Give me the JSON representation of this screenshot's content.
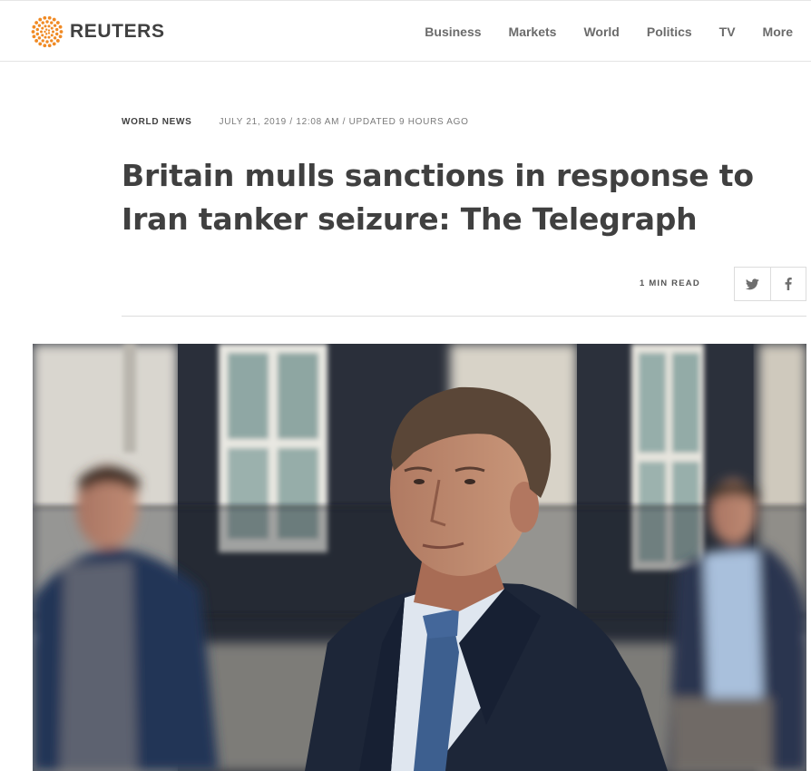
{
  "header": {
    "logo": {
      "name": "REUTERS",
      "icon": "reuters-dots-logo",
      "color": "#f08a24"
    },
    "nav": [
      {
        "label": "Business"
      },
      {
        "label": "Markets"
      },
      {
        "label": "World"
      },
      {
        "label": "Politics"
      },
      {
        "label": "TV"
      },
      {
        "label": "More"
      }
    ]
  },
  "article": {
    "section": "WORLD NEWS",
    "dateline": "JULY 21, 2019 / 12:08 AM / UPDATED 9 HOURS AGO",
    "headline": "Britain mulls sanctions in response to Iran tanker seizure: The Telegraph",
    "read_time": "1 MIN READ",
    "share": [
      {
        "network": "twitter",
        "icon": "twitter-icon"
      },
      {
        "network": "facebook",
        "icon": "facebook-icon"
      }
    ],
    "hero_image": {
      "description_icon": "news-photo",
      "colors": {
        "bricks": "#2f3542",
        "suit": "#1e2a44",
        "tie": "#3b5b8a"
      }
    }
  }
}
